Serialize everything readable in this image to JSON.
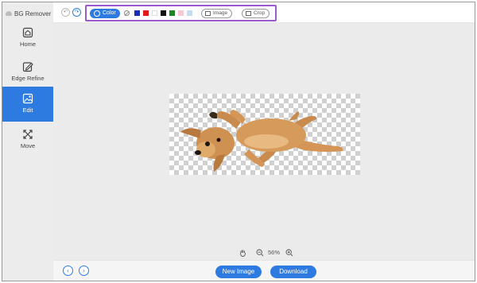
{
  "app": {
    "title": "BG Remover"
  },
  "sidebar": {
    "items": [
      {
        "label": "Home",
        "icon": "home-icon",
        "active": false
      },
      {
        "label": "Edge Refine",
        "icon": "edge-refine-icon",
        "active": false
      },
      {
        "label": "Edit",
        "icon": "edit-image-icon",
        "active": true
      },
      {
        "label": "Move",
        "icon": "move-icon",
        "active": false
      }
    ]
  },
  "toolbar": {
    "undo_icon": "undo-icon",
    "redo_icon": "redo-icon",
    "color_label": "Color",
    "swatches": [
      "none",
      "#1a2fb8",
      "#e01b1b",
      "#ffffff",
      "#111111",
      "#17891f",
      "#f6c8d6",
      "#c8d9f3"
    ],
    "image_label": "Image",
    "crop_label": "Crop",
    "highlight_color": "#9b59d0",
    "accent_color": "#2d7be0"
  },
  "zoom": {
    "value": "56%"
  },
  "bottom": {
    "new_image_label": "New Image",
    "download_label": "Download"
  }
}
